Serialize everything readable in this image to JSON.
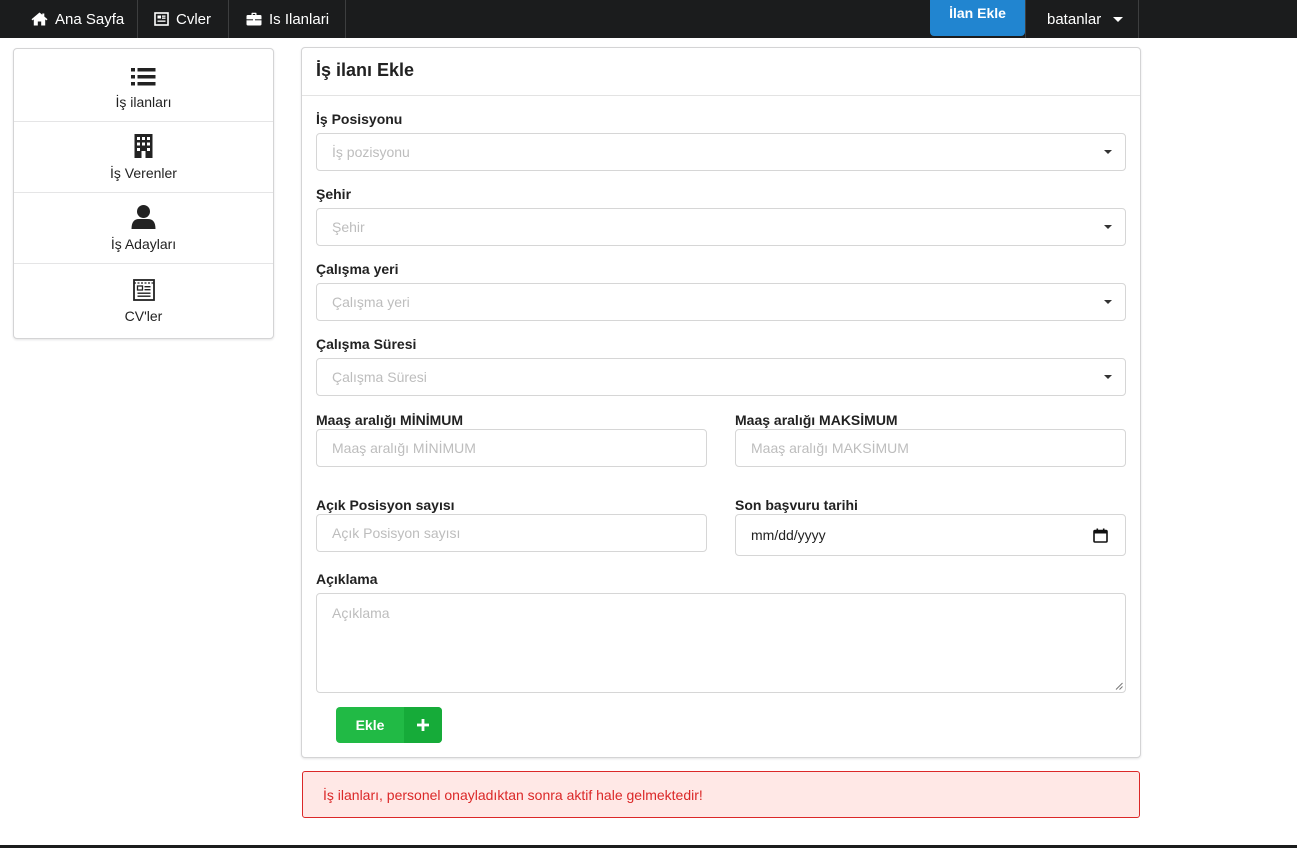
{
  "navbar": {
    "home": {
      "label": "Ana Sayfa",
      "icon": "home-icon"
    },
    "cvs": {
      "label": "Cvler",
      "icon": "cv-list-icon"
    },
    "jobs": {
      "label": "Is Ilanlari",
      "icon": "briefcase-icon"
    },
    "add_listing_button": "İlan Ekle",
    "user": {
      "label": "batanlar",
      "icon": "chevron-down-icon"
    }
  },
  "sidebar": {
    "items": [
      {
        "label": "İş ilanları",
        "icon": "list-icon"
      },
      {
        "label": "İş Verenler",
        "icon": "building-icon"
      },
      {
        "label": "İş Adayları",
        "icon": "user-icon"
      },
      {
        "label": "CV'ler",
        "icon": "newspaper-icon"
      }
    ]
  },
  "form": {
    "title": "İş ilanı Ekle",
    "position": {
      "label": "İş Posisyonu",
      "placeholder": "İş pozisyonu"
    },
    "city": {
      "label": "Şehir",
      "placeholder": "Şehir"
    },
    "workplace": {
      "label": "Çalışma yeri",
      "placeholder": "Çalışma yeri"
    },
    "duration": {
      "label": "Çalışma Süresi",
      "placeholder": "Çalışma Süresi"
    },
    "salary_min": {
      "label": "Maaş aralığı MİNİMUM",
      "placeholder": "Maaş aralığı MİNİMUM"
    },
    "salary_max": {
      "label": "Maaş aralığı MAKSİMUM",
      "placeholder": "Maaş aralığı MAKSİMUM"
    },
    "open_positions": {
      "label": "Açık Posisyon sayısı",
      "placeholder": "Açık Posisyon sayısı"
    },
    "deadline": {
      "label": "Son başvuru tarihi",
      "value": "mm/dd/yyyy"
    },
    "description": {
      "label": "Açıklama",
      "placeholder": "Açıklama"
    },
    "submit_label": "Ekle"
  },
  "alert": {
    "text": "İş ilanları, personel onayladıktan sonra aktif hale gelmektedir!"
  },
  "colors": {
    "navbar_bg": "#1b1c1d",
    "primary_blue": "#2185d0",
    "success_green": "#21ba45",
    "error_red": "#db2828",
    "error_bg": "#ffe8e6"
  }
}
